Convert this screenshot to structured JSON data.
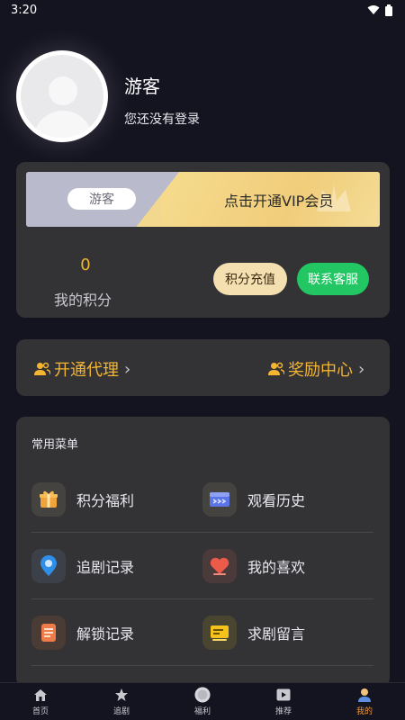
{
  "status_bar": {
    "time": "3:20"
  },
  "profile": {
    "name": "游客",
    "hint": "您还没有登录"
  },
  "vip": {
    "badge": "游客",
    "cta": "点击开通VIP会员"
  },
  "points": {
    "value": "0",
    "label": "我的积分",
    "recharge": "积分充值",
    "service": "联系客服"
  },
  "links": {
    "agent": "开通代理",
    "rewards": "奖励中心"
  },
  "menu": {
    "title": "常用菜单",
    "items": [
      {
        "label": "积分福利",
        "icon": "gift-icon"
      },
      {
        "label": "观看历史",
        "icon": "history-icon"
      },
      {
        "label": "追剧记录",
        "icon": "location-pin-icon"
      },
      {
        "label": "我的喜欢",
        "icon": "heart-icon"
      },
      {
        "label": "解锁记录",
        "icon": "document-icon"
      },
      {
        "label": "求剧留言",
        "icon": "message-icon"
      }
    ]
  },
  "nav": {
    "items": [
      {
        "label": "首页",
        "icon": "home-icon"
      },
      {
        "label": "追剧",
        "icon": "star-icon"
      },
      {
        "label": "福利",
        "icon": "coin-icon"
      },
      {
        "label": "推荐",
        "icon": "play-icon"
      },
      {
        "label": "我的",
        "icon": "user-icon"
      }
    ],
    "active": "我的"
  },
  "colors": {
    "accent": "#f4b532",
    "service_green": "#22c663",
    "active_nav": "#f39a37",
    "background": "#141320",
    "card": "#333234"
  }
}
